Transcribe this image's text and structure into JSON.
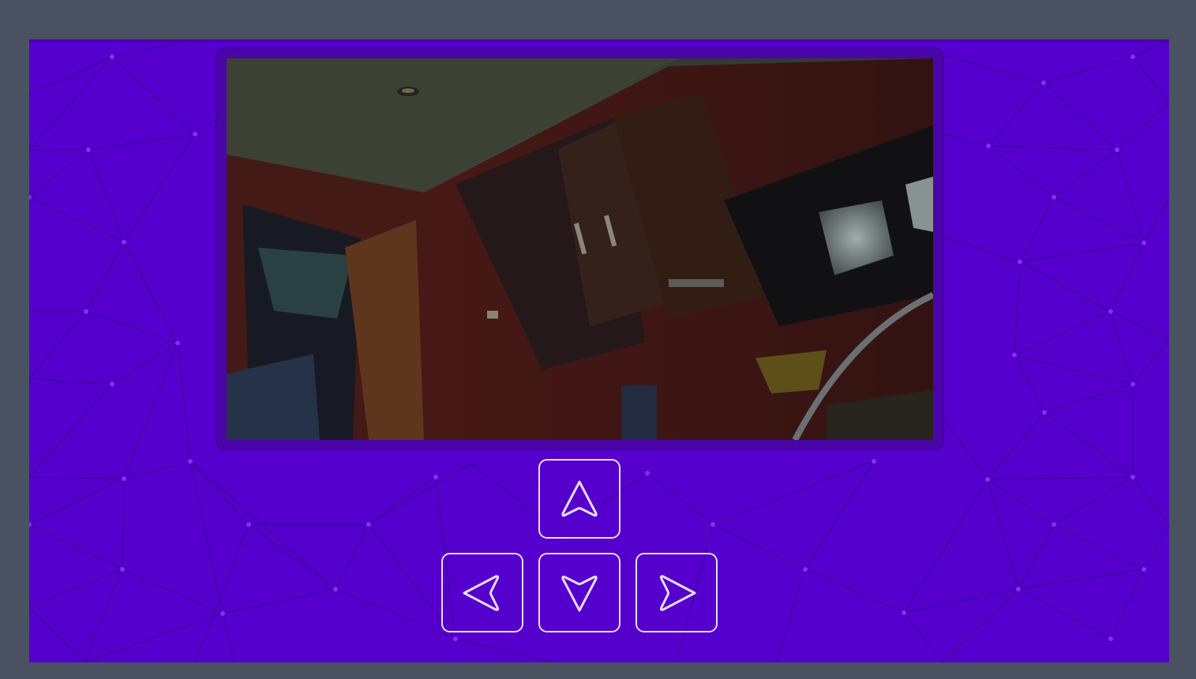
{
  "app": {
    "background_color": "#5500cc",
    "frame_color": "#4a5160",
    "mesh_line_color": "#3a0090",
    "mesh_node_color": "#8a2cff"
  },
  "video": {
    "label": "",
    "description_icon": "camera-feed"
  },
  "controls": {
    "accent_color": "#e8dcff",
    "buttons": [
      {
        "id": "up",
        "icon": "arrow-up-icon"
      },
      {
        "id": "left",
        "icon": "arrow-left-icon"
      },
      {
        "id": "down",
        "icon": "arrow-down-icon"
      },
      {
        "id": "right",
        "icon": "arrow-right-icon"
      }
    ]
  }
}
